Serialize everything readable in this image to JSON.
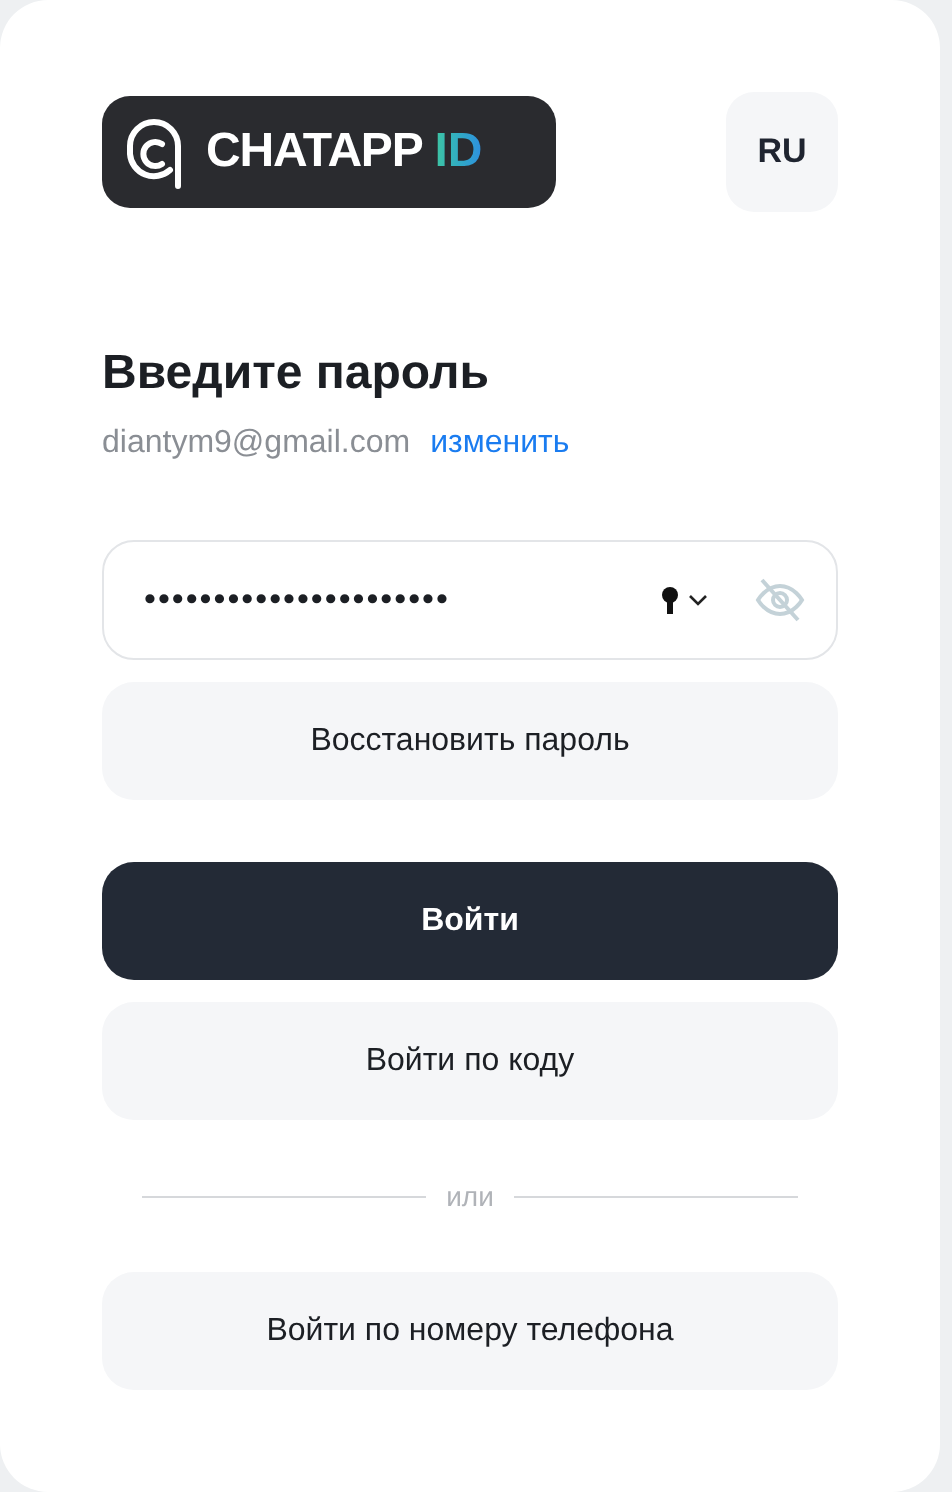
{
  "logo": {
    "name": "CHATAPP",
    "suffix": "ID"
  },
  "language": "RU",
  "title": "Введите пароль",
  "email": "diantym9@gmail.com",
  "change_link": "изменить",
  "password": {
    "value": "••••••••••••••••••••••",
    "visible": false
  },
  "buttons": [
    {
      "label": "Восстановить пароль",
      "kind": "secondary"
    },
    {
      "label": "Войти",
      "kind": "primary"
    },
    {
      "label": "Войти по коду",
      "kind": "secondary"
    }
  ],
  "divider": "или",
  "phone_button": {
    "label": "Войти по номеру телефона",
    "kind": "secondary"
  }
}
